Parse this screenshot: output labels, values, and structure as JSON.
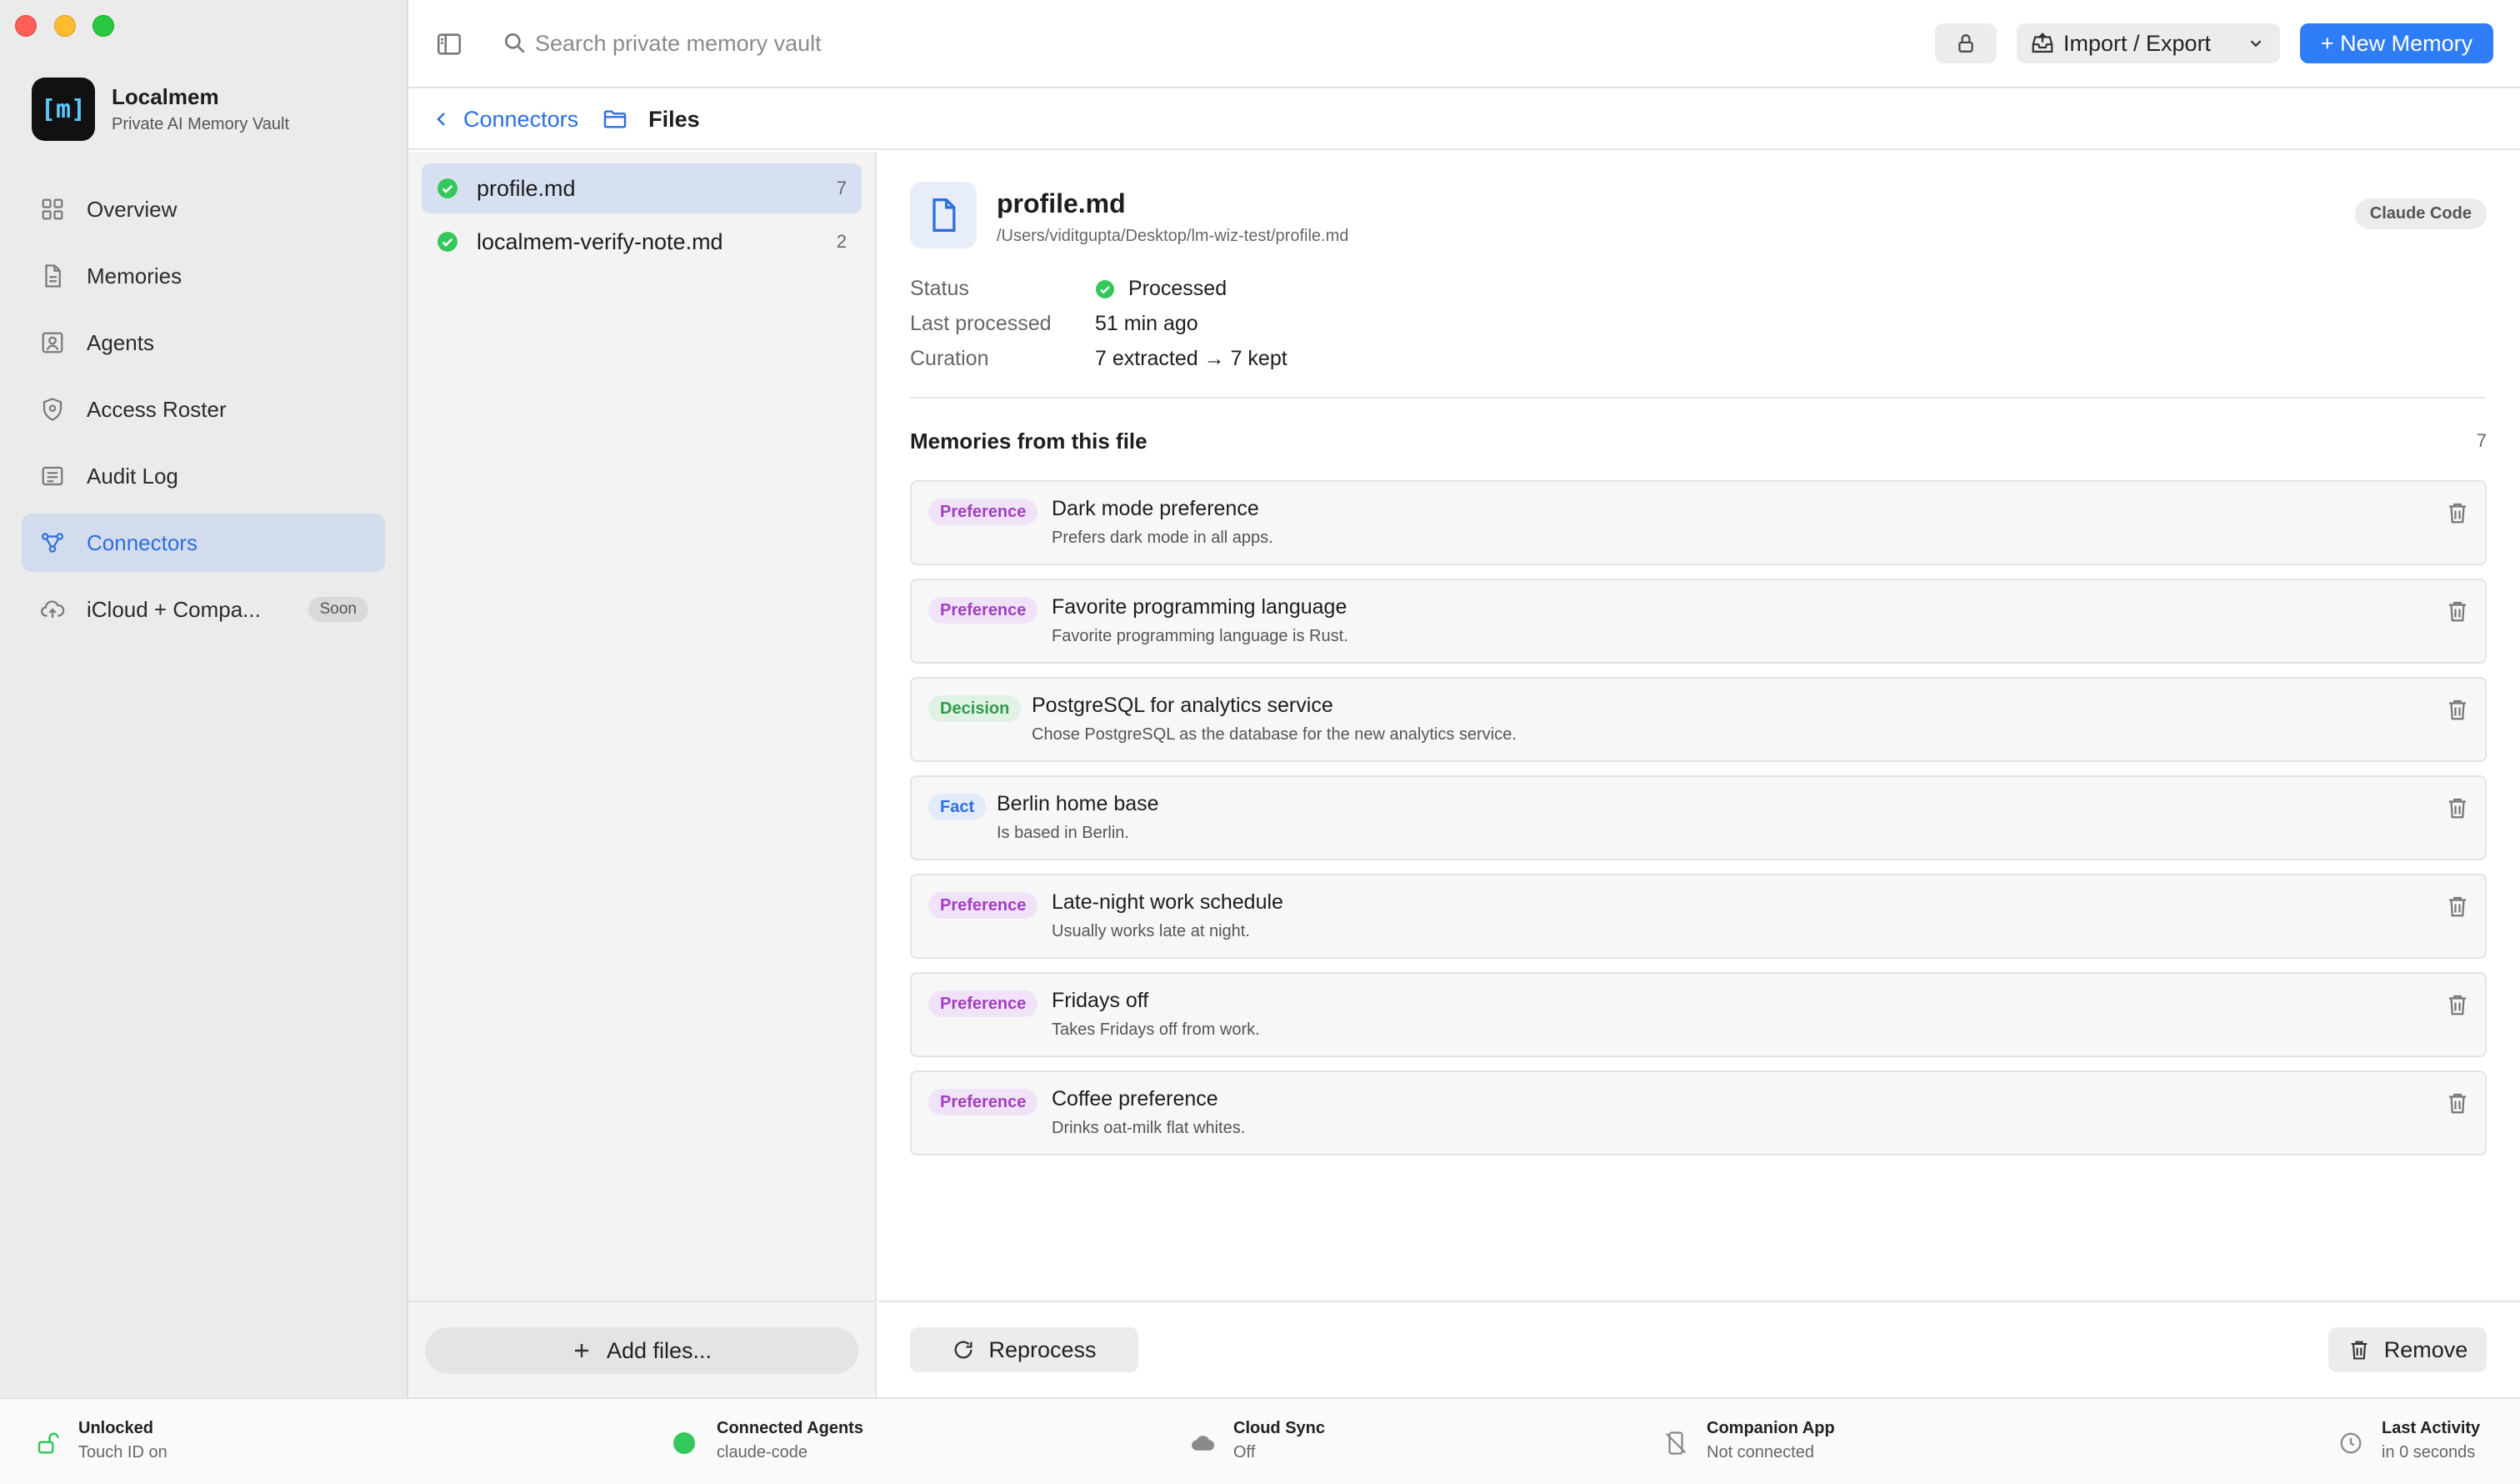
{
  "app": {
    "name": "Localmem",
    "subtitle": "Private AI Memory Vault",
    "logo_text": "[m]"
  },
  "sidebar": {
    "items": [
      {
        "label": "Overview",
        "icon": "grid-icon"
      },
      {
        "label": "Memories",
        "icon": "document-icon"
      },
      {
        "label": "Agents",
        "icon": "person-icon"
      },
      {
        "label": "Access Roster",
        "icon": "shield-icon"
      },
      {
        "label": "Audit Log",
        "icon": "list-icon"
      },
      {
        "label": "Connectors",
        "icon": "connectors-icon",
        "active": true
      },
      {
        "label": "iCloud + Compa...",
        "icon": "cloud-upload-icon",
        "badge": "Soon"
      }
    ]
  },
  "toolbar": {
    "search_placeholder": "Search private memory vault",
    "import_export_label": "Import / Export",
    "new_memory_label": "+ New Memory"
  },
  "breadcrumb": {
    "back_label": "Connectors",
    "current": "Files"
  },
  "files": [
    {
      "name": "profile.md",
      "count": "7",
      "status": "processed",
      "selected": true
    },
    {
      "name": "localmem-verify-note.md",
      "count": "2",
      "status": "processed",
      "selected": false
    }
  ],
  "file_panel": {
    "add_files_label": "Add files..."
  },
  "detail": {
    "title": "profile.md",
    "path": "/Users/viditgupta/Desktop/lm-wiz-test/profile.md",
    "source_badge": "Claude Code",
    "meta": [
      {
        "label": "Status",
        "value": "Processed",
        "icon": "check-circle-icon"
      },
      {
        "label": "Last processed",
        "value": "51 min ago"
      },
      {
        "label": "Curation",
        "value": "7 extracted → 7 kept"
      }
    ],
    "memories_heading": "Memories from this file",
    "memories_count": "7",
    "memories": [
      {
        "tag": "Preference",
        "kind": "pref",
        "title": "Dark mode preference",
        "description": "Prefers dark mode in all apps."
      },
      {
        "tag": "Preference",
        "kind": "pref",
        "title": "Favorite programming language",
        "description": "Favorite programming language is Rust."
      },
      {
        "tag": "Decision",
        "kind": "decision",
        "title": "PostgreSQL for analytics service",
        "description": "Chose PostgreSQL as the database for the new analytics service."
      },
      {
        "tag": "Fact",
        "kind": "fact",
        "title": "Berlin home base",
        "description": "Is based in Berlin."
      },
      {
        "tag": "Preference",
        "kind": "pref",
        "title": "Late-night work schedule",
        "description": "Usually works late at night."
      },
      {
        "tag": "Preference",
        "kind": "pref",
        "title": "Fridays off",
        "description": "Takes Fridays off from work."
      },
      {
        "tag": "Preference",
        "kind": "pref",
        "title": "Coffee preference",
        "description": "Drinks oat-milk flat whites."
      }
    ],
    "reprocess_label": "Reprocess",
    "remove_label": "Remove"
  },
  "statusbar": {
    "items": [
      {
        "title": "Unlocked",
        "sub": "Touch ID on",
        "icon": "unlock-icon"
      },
      {
        "title": "Connected Agents",
        "sub": "claude-code",
        "icon": "green-dot"
      },
      {
        "title": "Cloud Sync",
        "sub": "Off",
        "icon": "cloud-icon"
      },
      {
        "title": "Companion App",
        "sub": "Not connected",
        "icon": "phone-slash-icon"
      },
      {
        "title": "Last Activity",
        "sub": "in 0 seconds",
        "icon": "clock-icon"
      }
    ]
  },
  "colors": {
    "accent": "#2f7df6",
    "preference_tag": "#a43ec2",
    "decision_tag": "#2f9a4b",
    "fact_tag": "#2d6fdf",
    "status_green": "#34c759"
  }
}
